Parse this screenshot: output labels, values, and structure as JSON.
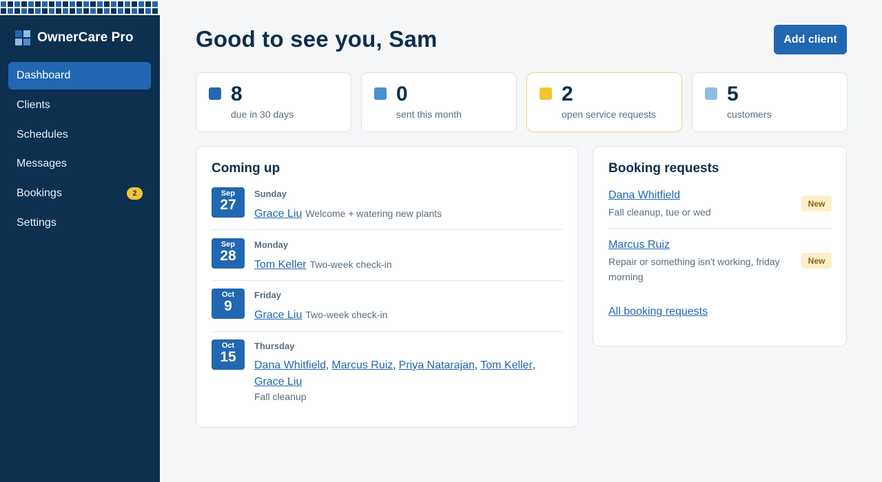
{
  "app": {
    "name": "OwnerCare Pro",
    "logo_icon": "grid-logo-icon",
    "colors": {
      "sidebar": "#0b3050",
      "accent": "#2167b1",
      "warn": "#f3c332",
      "text": "#0d2e4d",
      "muted": "#5b6d7e"
    }
  },
  "sidebar": {
    "items": [
      {
        "label": "Dashboard",
        "active": true
      },
      {
        "label": "Clients"
      },
      {
        "label": "Schedules"
      },
      {
        "label": "Messages"
      },
      {
        "label": "Bookings",
        "badge": "2"
      },
      {
        "label": "Settings"
      }
    ]
  },
  "header": {
    "greeting": "Good to see you, Sam",
    "add_label": "Add client"
  },
  "stats": [
    {
      "value": "8",
      "label": "due in 30 days",
      "color": "#2167b1"
    },
    {
      "value": "0",
      "label": "sent this month",
      "color": "#4a8fd0"
    },
    {
      "value": "2",
      "label": "open service requests",
      "color": "#f3c332"
    },
    {
      "value": "5",
      "label": "customers",
      "color": "#8ebde4"
    }
  ],
  "coming_up": {
    "title": "Coming up",
    "events": [
      {
        "month": "Sep",
        "day": "27",
        "weekday": "Sunday",
        "clients": [
          "Grace Liu"
        ],
        "desc": "Welcome + watering new plants"
      },
      {
        "month": "Sep",
        "day": "28",
        "weekday": "Monday",
        "clients": [
          "Tom Keller"
        ],
        "desc": "Two-week check-in"
      },
      {
        "month": "Oct",
        "day": "9",
        "weekday": "Friday",
        "clients": [
          "Grace Liu"
        ],
        "desc": "Two-week check-in"
      },
      {
        "month": "Oct",
        "day": "15",
        "weekday": "Thursday",
        "clients": [
          "Dana Whitfield",
          "Marcus Ruiz",
          "Priya Natarajan",
          "Tom Keller",
          "Grace Liu"
        ],
        "desc": "Fall cleanup"
      }
    ]
  },
  "booking_requests": {
    "title": "Booking requests",
    "requests": [
      {
        "name": "Dana Whitfield",
        "desc": "Fall cleanup, tue or wed",
        "badge": "New"
      },
      {
        "name": "Marcus Ruiz",
        "desc": "Repair or something isn't working, friday morning",
        "badge": "New"
      }
    ],
    "all_link": "All booking requests"
  }
}
